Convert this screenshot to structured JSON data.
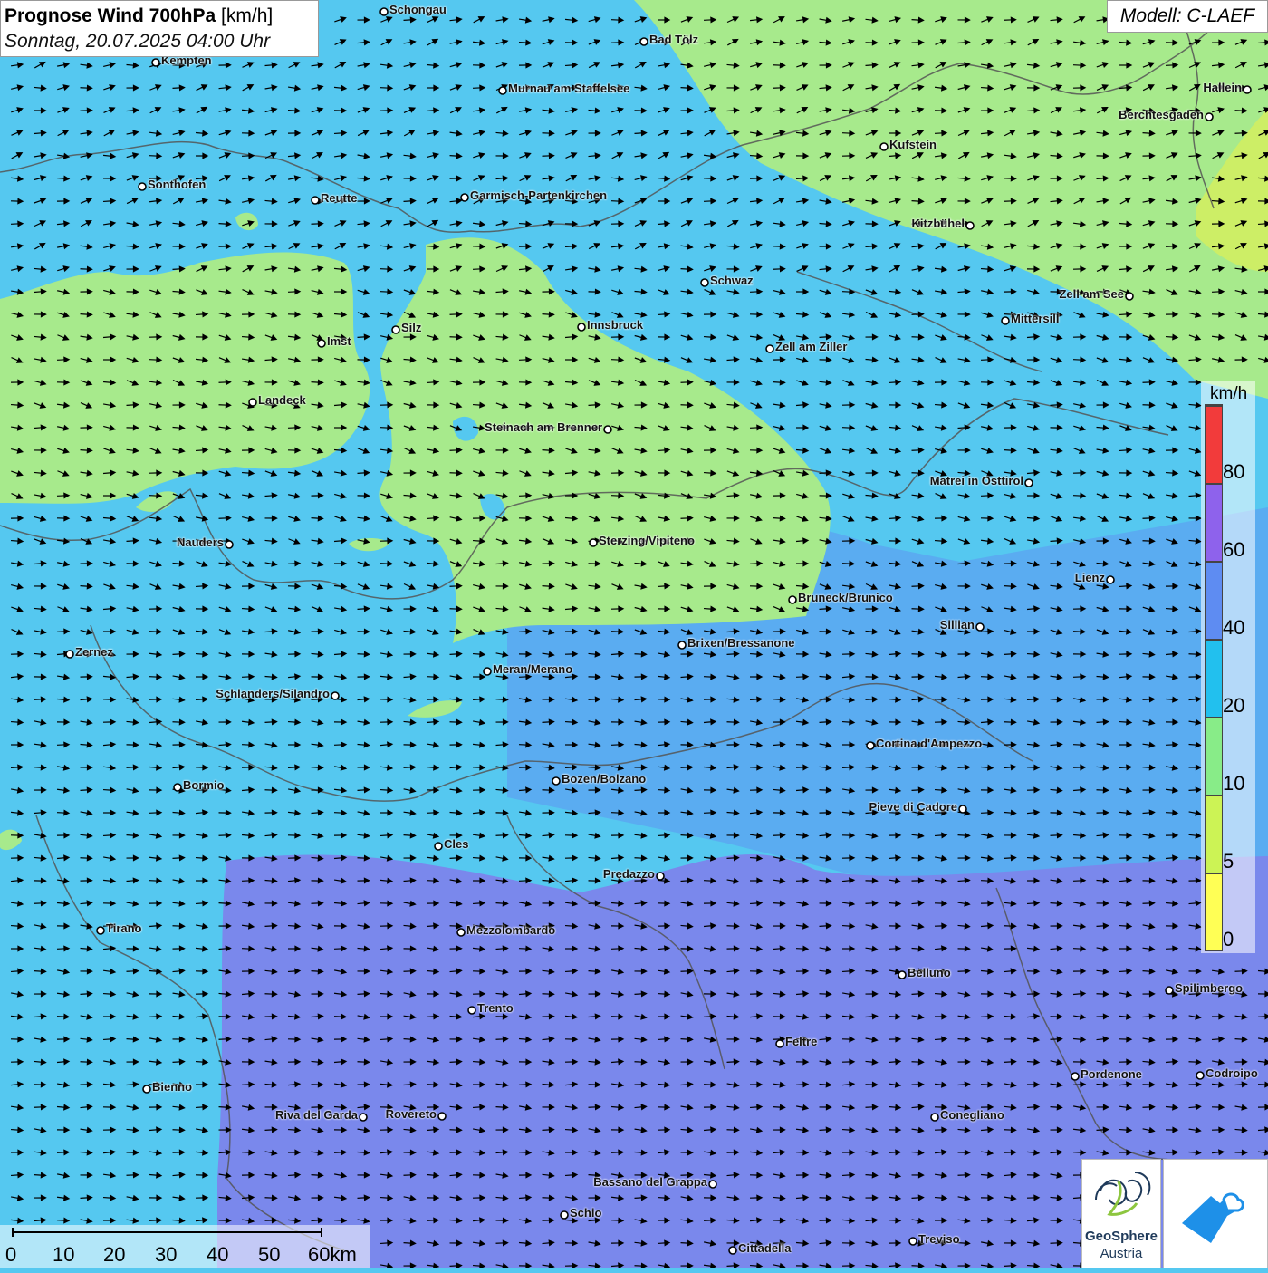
{
  "header": {
    "title_bold": "Prognose Wind 700hPa",
    "title_unit": "[km/h]",
    "date": "Sonntag, 20.07.2025 04:00 Uhr",
    "model": "Modell: C-LAEF"
  },
  "legend": {
    "unit": "km/h",
    "classes": [
      {
        "label": "0",
        "color": "#ffff55"
      },
      {
        "label": "5",
        "color": "#ccf355"
      },
      {
        "label": "10",
        "color": "#88ec88"
      },
      {
        "label": "20",
        "color": "#22c0ee"
      },
      {
        "label": "40",
        "color": "#5e8cf2"
      },
      {
        "label": "60",
        "color": "#8e62ec"
      },
      {
        "label": "80",
        "color": "#f23b3b"
      }
    ]
  },
  "scalebar": {
    "labels": [
      "0",
      "10",
      "20",
      "30",
      "40",
      "50",
      "60km"
    ]
  },
  "logos": {
    "geosphere_line1": "GeoSphere",
    "geosphere_line2": "Austria"
  },
  "colors": {
    "calm_green": "#a7ea8c",
    "light_blue": "#55c8f0",
    "mid_blue": "#5aaaf0",
    "purple_blue": "#7a86ec",
    "border": "#555555"
  },
  "cities": [
    {
      "name": "Schongau",
      "label_side": "right"
    },
    {
      "name": "Bad Tölz",
      "label_side": "right"
    },
    {
      "name": "Kempten",
      "label_side": "right"
    },
    {
      "name": "Murnau am Staffelsee",
      "label_side": "right"
    },
    {
      "name": "Hallein",
      "label_side": "left"
    },
    {
      "name": "Berchtesgaden",
      "label_side": "left"
    },
    {
      "name": "Kufstein",
      "label_side": "right"
    },
    {
      "name": "Sonthofen",
      "label_side": "right"
    },
    {
      "name": "Reutte",
      "label_side": "right"
    },
    {
      "name": "Garmisch-Partenkirchen",
      "label_side": "right"
    },
    {
      "name": "Kitzbühel",
      "label_side": "left"
    },
    {
      "name": "Schwaz",
      "label_side": "right"
    },
    {
      "name": "Zell am See",
      "label_side": "left"
    },
    {
      "name": "Innsbruck",
      "label_side": "right"
    },
    {
      "name": "Mittersill",
      "label_side": "right"
    },
    {
      "name": "Imst",
      "label_side": "right"
    },
    {
      "name": "Silz",
      "label_side": "right"
    },
    {
      "name": "Zell am Ziller",
      "label_side": "right"
    },
    {
      "name": "Landeck",
      "label_side": "right"
    },
    {
      "name": "Steinach am Brenner",
      "label_side": "left"
    },
    {
      "name": "Matrei in Osttirol",
      "label_side": "left"
    },
    {
      "name": "Nauders",
      "label_side": "left"
    },
    {
      "name": "Sterzing/Vipiteno",
      "label_side": "right"
    },
    {
      "name": "Lienz",
      "label_side": "left"
    },
    {
      "name": "Bruneck/Brunico",
      "label_side": "right"
    },
    {
      "name": "Sillian",
      "label_side": "left"
    },
    {
      "name": "Brixen/Bressanone",
      "label_side": "right"
    },
    {
      "name": "Zernez",
      "label_side": "right"
    },
    {
      "name": "Meran/Merano",
      "label_side": "right"
    },
    {
      "name": "Schlanders/Silandro",
      "label_side": "left"
    },
    {
      "name": "Cortina d'Ampezzo",
      "label_side": "right"
    },
    {
      "name": "Bozen/Bolzano",
      "label_side": "right"
    },
    {
      "name": "Bormio",
      "label_side": "right"
    },
    {
      "name": "Pieve di Cadore",
      "label_side": "left"
    },
    {
      "name": "Cles",
      "label_side": "right"
    },
    {
      "name": "Predazzo",
      "label_side": "left"
    },
    {
      "name": "Tirano",
      "label_side": "right"
    },
    {
      "name": "Mezzolombardo",
      "label_side": "right"
    },
    {
      "name": "Belluno",
      "label_side": "right"
    },
    {
      "name": "Spilimbergo",
      "label_side": "right"
    },
    {
      "name": "Trento",
      "label_side": "right"
    },
    {
      "name": "Feltre",
      "label_side": "right"
    },
    {
      "name": "Pordenone",
      "label_side": "right"
    },
    {
      "name": "Codroipo",
      "label_side": "right"
    },
    {
      "name": "Bienno",
      "label_side": "right"
    },
    {
      "name": "Riva del Garda",
      "label_side": "left"
    },
    {
      "name": "Rovereto",
      "label_side": "left"
    },
    {
      "name": "Conegliano",
      "label_side": "right"
    },
    {
      "name": "Bassano del Grappa",
      "label_side": "left"
    },
    {
      "name": "Schio",
      "label_side": "right"
    },
    {
      "name": "Treviso",
      "label_side": "right"
    },
    {
      "name": "Cittadella",
      "label_side": "right"
    }
  ]
}
